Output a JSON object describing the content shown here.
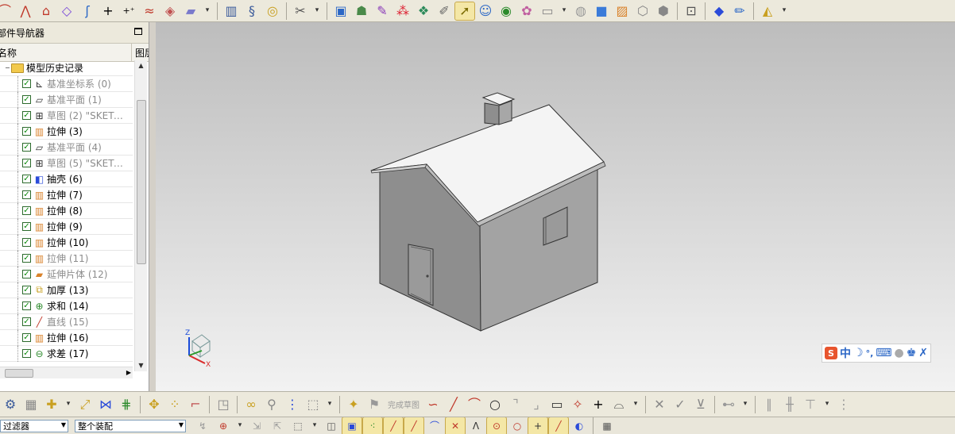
{
  "top_toolbar": {
    "icons": [
      "sketch-icon",
      "arc-icon",
      "profile-icon",
      "datum-plane-icon",
      "curve-icon",
      "point-icon",
      "point-set-icon",
      "extract-curve-icon",
      "surface-icon",
      "shell-surface-icon",
      "cylinder-icon",
      "spring-icon",
      "gear-icon",
      "tools-icon",
      "play-icon",
      "robot-icon",
      "pen-icon",
      "colors-icon",
      "palette-icon",
      "brush-icon",
      "select-icon",
      "person-icon",
      "camera-icon",
      "render-icon",
      "layer-icon",
      "orient-icon",
      "cube-icon",
      "image-icon",
      "wireframe-icon",
      "box-icon",
      "fit-view-icon",
      "solid-icon",
      "paint-icon",
      "display-icon"
    ]
  },
  "navigator": {
    "title": "部件导航器",
    "col_name": "名称",
    "col_graph": "图层",
    "root": "模型历史记录",
    "items": [
      {
        "label": "基准坐标系 (0)",
        "icon": "datum-csys-icon",
        "dim": true
      },
      {
        "label": "基准平面 (1)",
        "icon": "datum-plane-icon",
        "dim": true
      },
      {
        "label": "草图 (2) \"SKETC...",
        "icon": "sketch-icon",
        "dim": true
      },
      {
        "label": "拉伸 (3)",
        "icon": "extrude-icon",
        "dim": false
      },
      {
        "label": "基准平面 (4)",
        "icon": "datum-plane-icon",
        "dim": true
      },
      {
        "label": "草图 (5) \"SKETC...",
        "icon": "sketch-icon",
        "dim": true
      },
      {
        "label": "抽壳 (6)",
        "icon": "shell-icon",
        "dim": false
      },
      {
        "label": "拉伸 (7)",
        "icon": "extrude-icon",
        "dim": false
      },
      {
        "label": "拉伸 (8)",
        "icon": "extrude-icon",
        "dim": false
      },
      {
        "label": "拉伸 (9)",
        "icon": "extrude-icon",
        "dim": false
      },
      {
        "label": "拉伸 (10)",
        "icon": "extrude-icon",
        "dim": false
      },
      {
        "label": "拉伸 (11)",
        "icon": "extrude-icon",
        "dim": true
      },
      {
        "label": "延伸片体 (12)",
        "icon": "extend-sheet-icon",
        "dim": true
      },
      {
        "label": "加厚 (13)",
        "icon": "thicken-icon",
        "dim": false
      },
      {
        "label": "求和 (14)",
        "icon": "unite-icon",
        "dim": false
      },
      {
        "label": "直线 (15)",
        "icon": "line-icon",
        "dim": true
      },
      {
        "label": "拉伸 (16)",
        "icon": "extrude-icon",
        "dim": false
      },
      {
        "label": "求差 (17)",
        "icon": "subtract-icon",
        "dim": false
      }
    ]
  },
  "viewport": {
    "triad": {
      "z": "Z",
      "x": "X"
    }
  },
  "ime_bar": {
    "logo": "S",
    "mode": "中"
  },
  "bottom_toolbar": {
    "finish_sketch_label": "完成草图"
  },
  "status_bar": {
    "filter_label": "过滤器",
    "filter_value": "整个装配"
  },
  "colors": {
    "accent": "#f4e7a6",
    "viewport_top": "#bdbdbd",
    "viewport_bottom": "#f2f2f2"
  }
}
